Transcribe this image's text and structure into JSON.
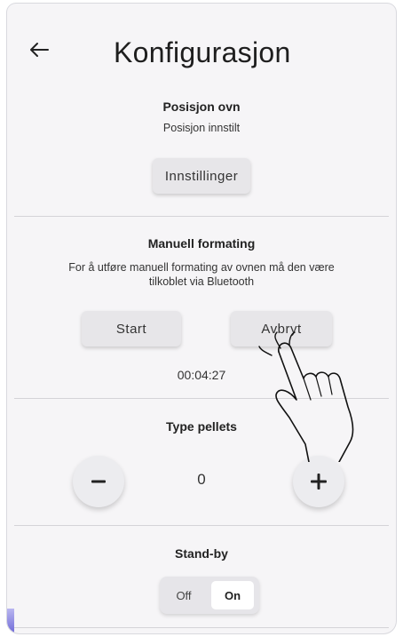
{
  "header": {
    "title": "Konfigurasjon"
  },
  "position": {
    "title": "Posisjon ovn",
    "status": "Posisjon innstilt",
    "settings_label": "Innstillinger"
  },
  "manual": {
    "title": "Manuell formating",
    "description_line1": "For å utføre manuell formating av ovnen må den være",
    "description_line2": "tilkoblet via Bluetooth",
    "start_label": "Start",
    "cancel_label": "Avbryt",
    "timer": "00:04:27"
  },
  "pellets": {
    "title": "Type pellets",
    "value": "0"
  },
  "standby": {
    "title": "Stand-by",
    "off_label": "Off",
    "on_label": "On",
    "selected": "On"
  },
  "icons": {
    "back": "arrow-left-icon",
    "minus": "minus-icon",
    "plus": "plus-icon",
    "pointer": "hand-pointer-icon"
  }
}
